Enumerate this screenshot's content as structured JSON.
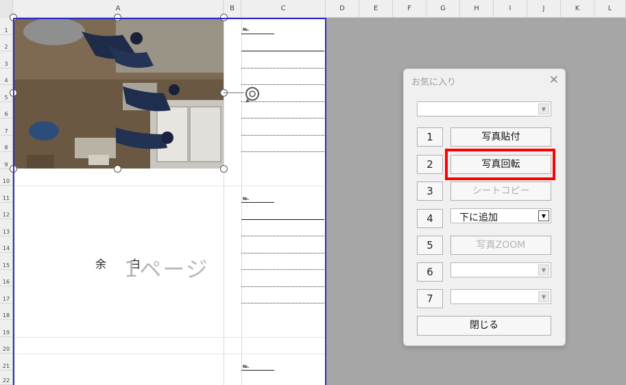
{
  "columns": [
    "A",
    "B",
    "C",
    "D",
    "E",
    "F",
    "G",
    "H",
    "I",
    "J",
    "K",
    "L"
  ],
  "rows": [
    "1",
    "2",
    "3",
    "4",
    "5",
    "6",
    "7",
    "8",
    "9",
    "10",
    "11",
    "12",
    "13",
    "14",
    "15",
    "16",
    "17",
    "18",
    "19",
    "20",
    "21",
    "22"
  ],
  "sheet": {
    "no_label": "№.",
    "yohaku_1": "余",
    "yohaku_2": "白",
    "page_label": "1ページ"
  },
  "dialog": {
    "title": "お気に入り",
    "close_glyph": "✕",
    "top_combo_value": "",
    "buttons": [
      {
        "num": "1",
        "label": "写真貼付",
        "enabled": true
      },
      {
        "num": "2",
        "label": "写真回転",
        "enabled": true
      },
      {
        "num": "3",
        "label": "シートコピー",
        "enabled": false
      },
      {
        "num": "4",
        "label": "下に追加",
        "type": "combo"
      },
      {
        "num": "5",
        "label": "写真ZOOM",
        "enabled": false
      },
      {
        "num": "6",
        "label": "",
        "type": "combo"
      },
      {
        "num": "7",
        "label": "",
        "type": "combo"
      }
    ],
    "close_label": "閉じる"
  },
  "icons": {
    "combo_arrow": "▼",
    "rotate": "rotate-icon"
  },
  "colors": {
    "page_border": "#2a2ac8",
    "highlight": "#ff0000"
  }
}
